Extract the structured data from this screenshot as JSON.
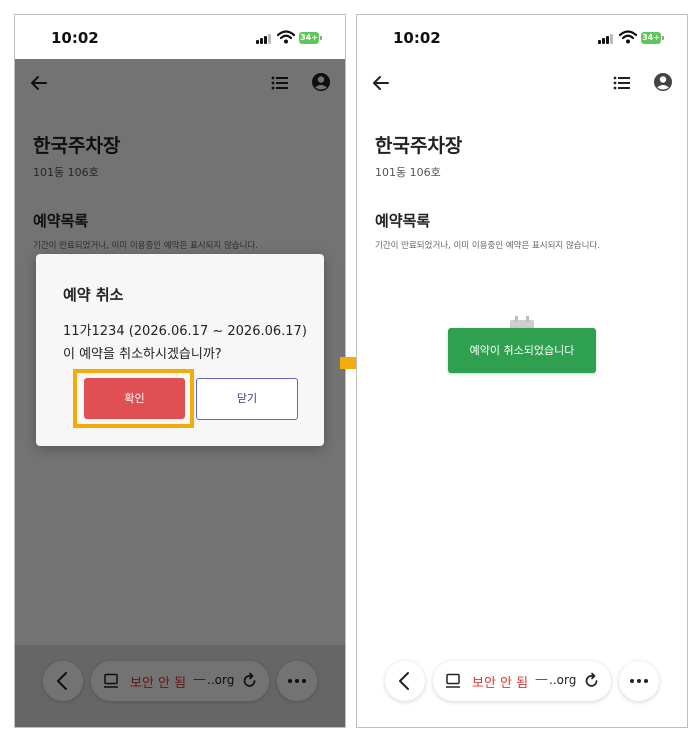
{
  "status_bar": {
    "time": "10:02",
    "battery": "34+"
  },
  "page": {
    "title": "한국주차장",
    "subtitle": "101동 106호",
    "section_title": "예약목록",
    "section_note": "기간이 만료되었거나, 이미 이용중인 예약은 표시되지 않습니다."
  },
  "dialog": {
    "title": "예약 취소",
    "detail": "11가1234  (2026.06.17 ~ 2026.06.17)",
    "question": "이 예약을 취소하시겠습니까?",
    "confirm_label": "확인",
    "close_label": "닫기"
  },
  "toast": {
    "message": "예약이 취소되었습니다"
  },
  "browser_bar": {
    "warning": "보안 안 됨",
    "separator": "—",
    "domain": "..org"
  },
  "icons": [
    "back-arrow-icon",
    "list-icon",
    "profile-icon",
    "calendar-icon",
    "tab-icon",
    "reload-icon",
    "chevron-left-icon",
    "more-icon",
    "arrow-right-icon"
  ],
  "colors": {
    "confirm": "#e05052",
    "close_border": "#6b64c8",
    "highlight": "#f3ac0a",
    "toast": "#2ea04f",
    "warning": "#d93636",
    "battery": "#5fc85a"
  }
}
